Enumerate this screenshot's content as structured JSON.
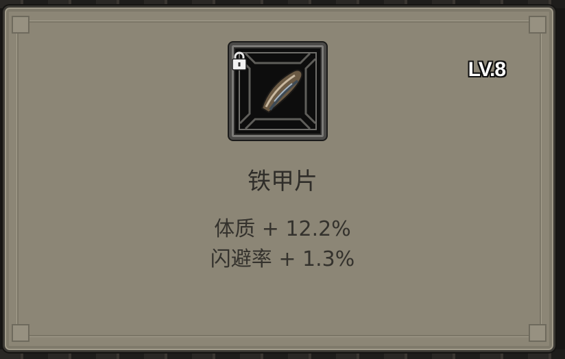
{
  "item": {
    "name": "铁甲片",
    "level": "LV.8",
    "locked": true,
    "icon": "armor-plate-icon",
    "stats": [
      {
        "label": "体质 + 12.2%"
      },
      {
        "label": "闪避率 + 1.3%"
      }
    ]
  },
  "colors": {
    "panel": "#8c8676",
    "text": "#2f2d29",
    "level_text": "#ffffff"
  }
}
